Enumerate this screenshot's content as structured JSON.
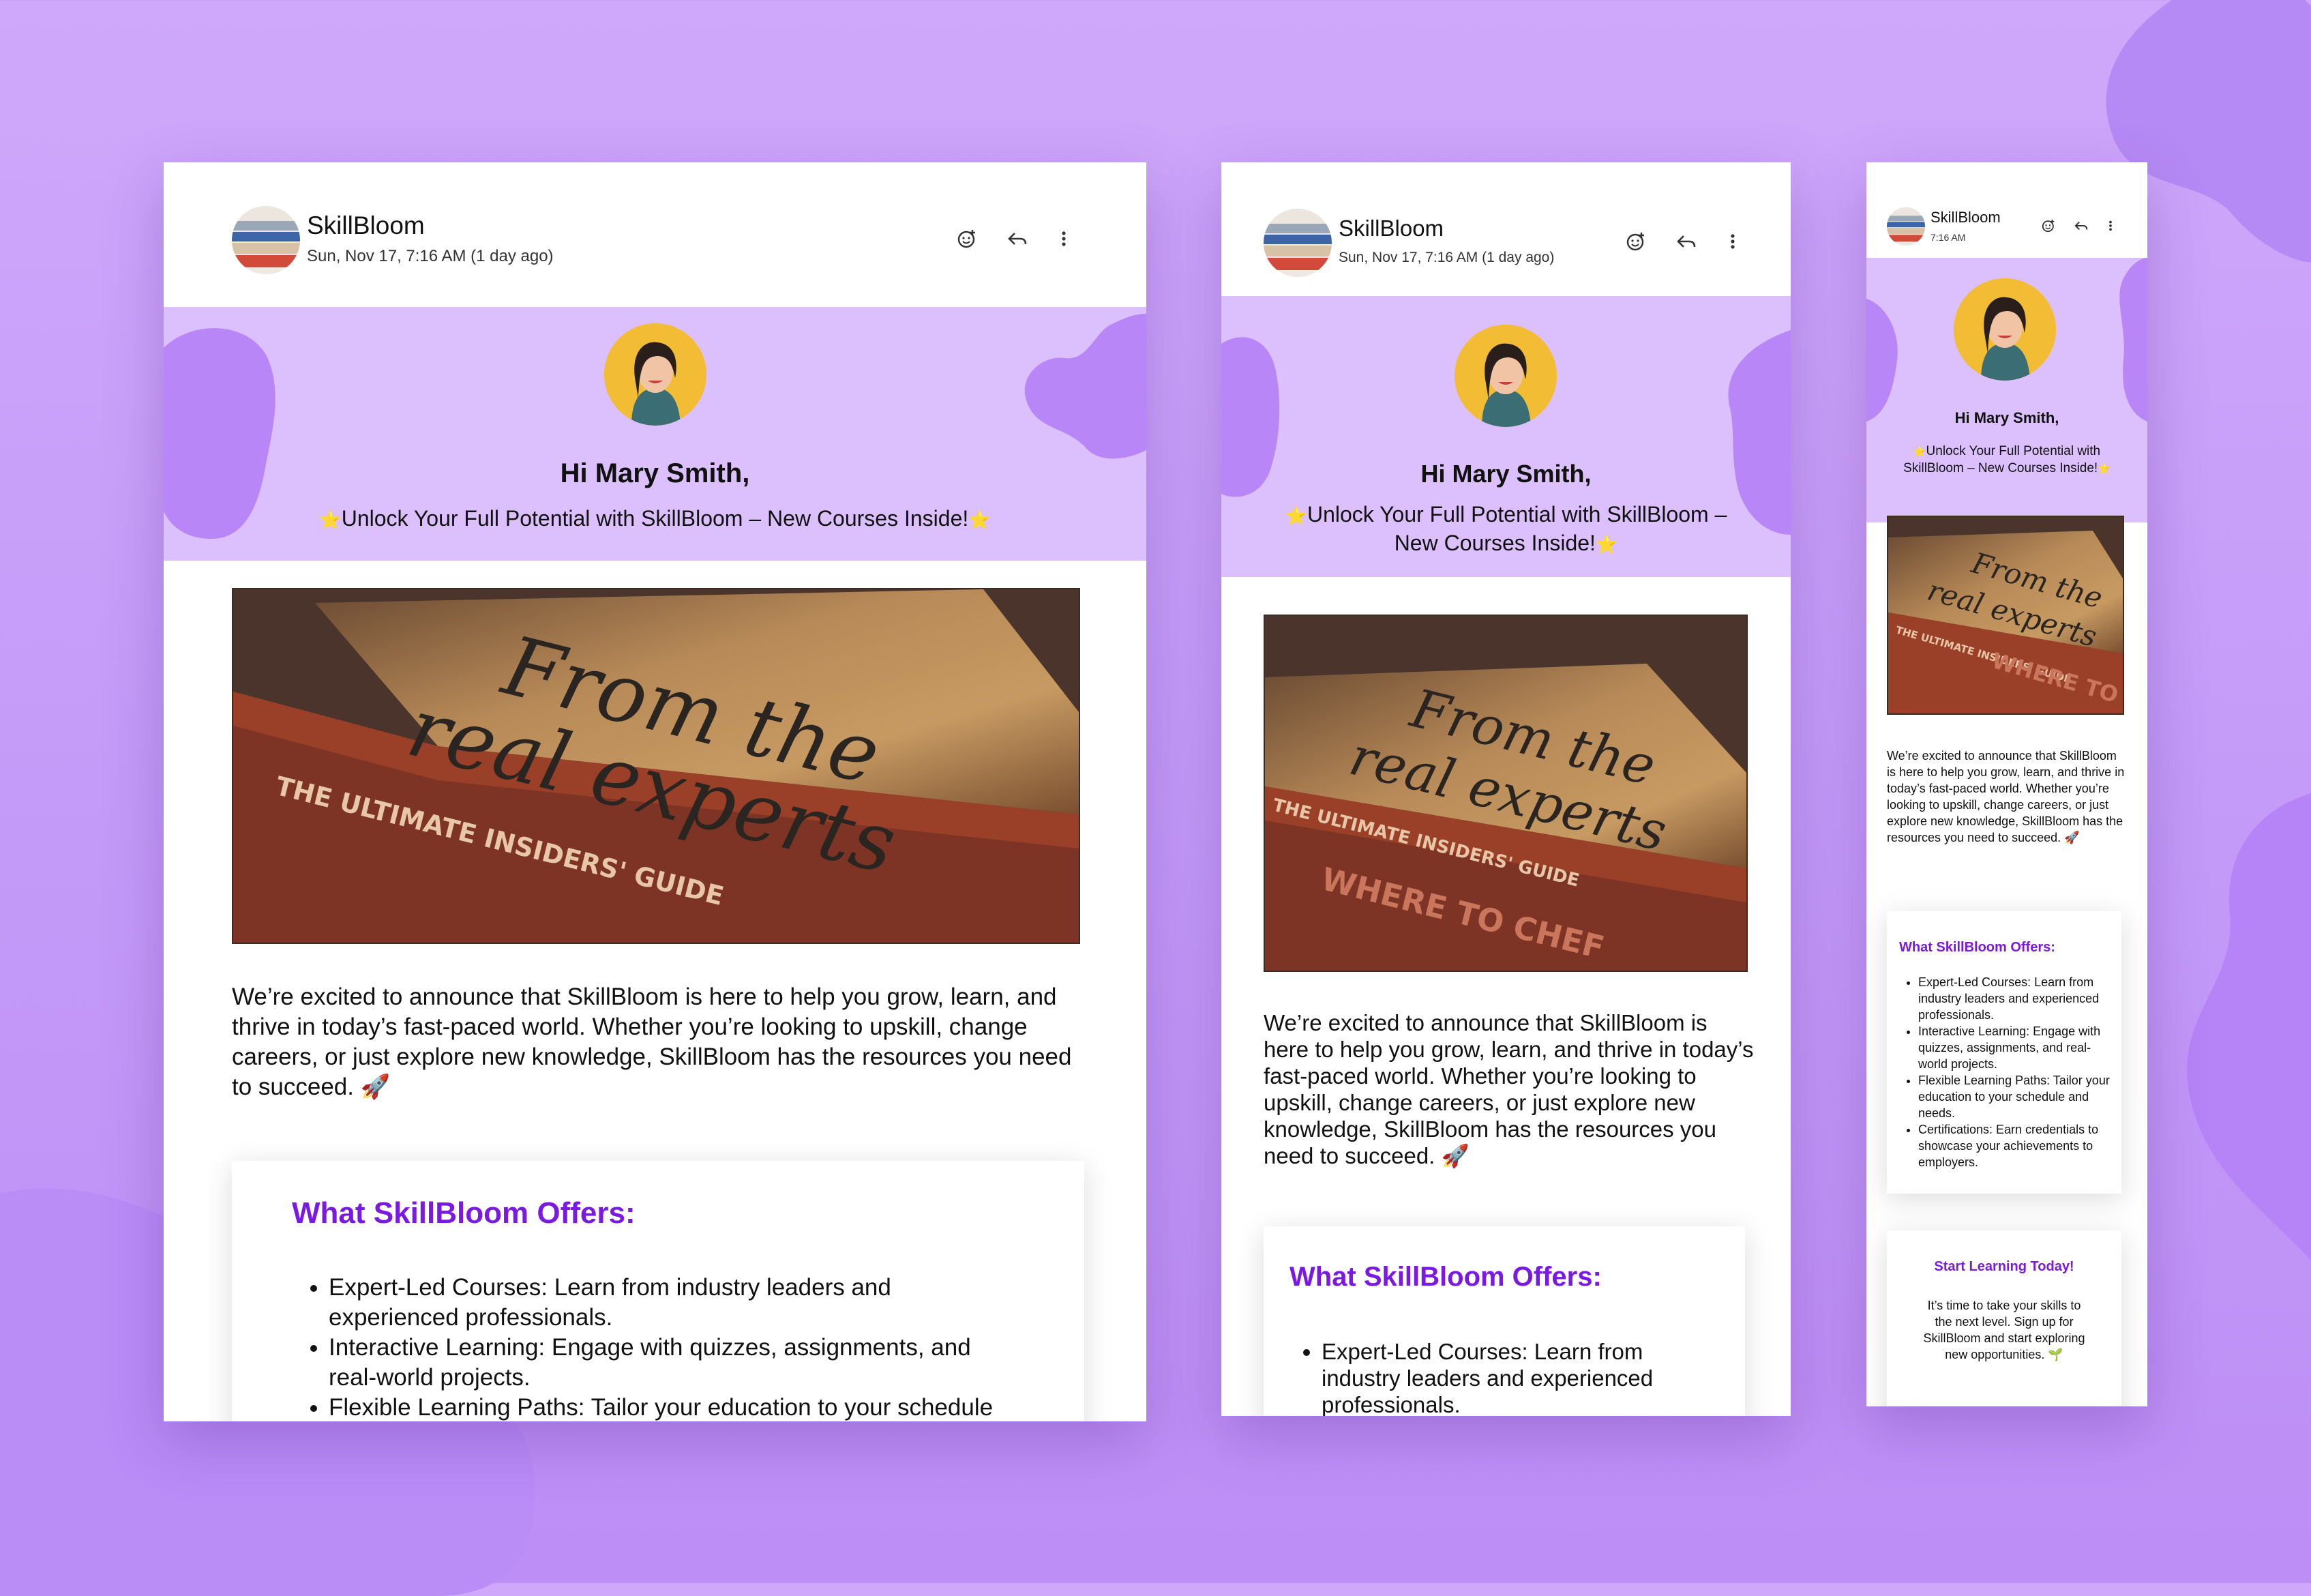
{
  "sender": "SkillBloom",
  "date_full": "Sun, Nov 17, 7:16 AM (1 day ago)",
  "date_short": "7:16 AM",
  "greeting": "Hi Mary Smith,",
  "subject": "Unlock Your Full Potential with SkillBloom – New Courses Inside!",
  "subject_star": "⭐",
  "hero_image_text": {
    "line1": "From the",
    "line2": "real experts",
    "spine": "THE ULTIMATE INSIDERS' GUIDE",
    "cover": "WHERE TO CHEF"
  },
  "intro": "We’re excited to announce that SkillBloom is here to help you grow, learn, and thrive in today’s fast-paced world. Whether you’re looking to upskill, change careers, or just explore new knowledge, SkillBloom has the resources you need to succeed. 🚀",
  "offers": {
    "title": "What SkillBloom Offers:",
    "items": [
      "Expert-Led Courses: Learn from industry leaders and experienced professionals.",
      "Interactive Learning: Engage with quizzes, assignments, and real-world projects.",
      "Flexible Learning Paths: Tailor your education to your schedule and needs.",
      "Certifications: Earn credentials to showcase your achievements to employers."
    ]
  },
  "cta": {
    "title": "Start Learning Today!",
    "text": "It’s time to take your skills to the next level. Sign up for SkillBloom and start exploring new opportunities. 🌱"
  },
  "icons": [
    "emoji-react-icon",
    "reply-icon",
    "more-vertical-icon"
  ],
  "colors": {
    "background": "#c9a1fa",
    "banner": "#dcc0fd",
    "blob": "#b685f5",
    "accent_heading": "#7a19e3"
  }
}
